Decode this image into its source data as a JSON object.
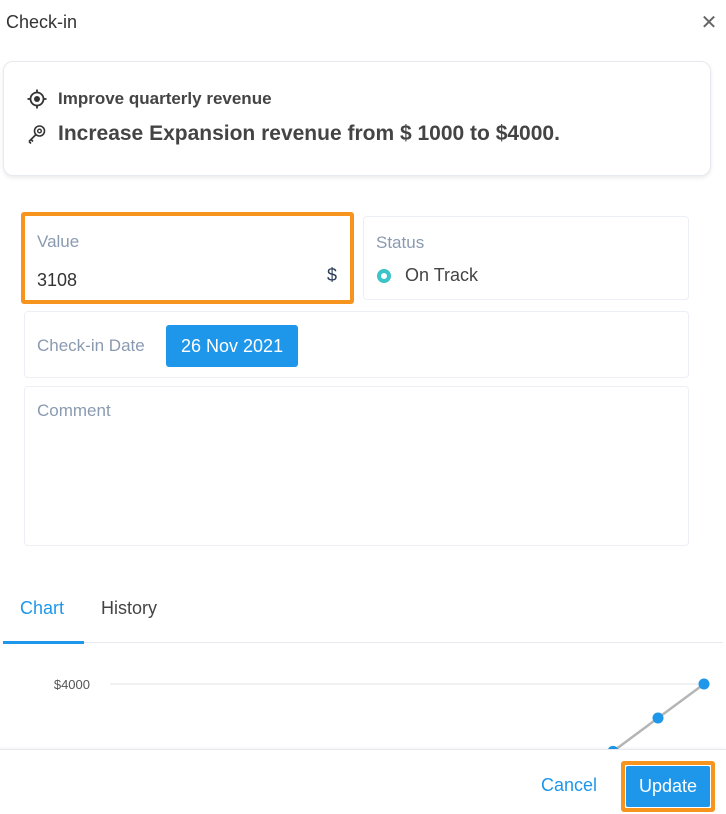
{
  "header": {
    "title": "Check-in",
    "close_icon": "close-icon"
  },
  "objective": {
    "title": "Improve quarterly revenue",
    "title_icon": "target-icon",
    "key_result": "Increase Expansion revenue from $ 1000 to $4000.",
    "key_result_icon": "key-icon"
  },
  "value_field": {
    "label": "Value",
    "value": "3108",
    "currency": "$"
  },
  "status_field": {
    "label": "Status",
    "value": "On Track",
    "color": "#3bc4c9"
  },
  "date_field": {
    "label": "Check-in Date",
    "value": "26 Nov 2021"
  },
  "comment_field": {
    "label": "Comment",
    "value": ""
  },
  "tabs": [
    {
      "label": "Chart",
      "active": true
    },
    {
      "label": "History",
      "active": false
    }
  ],
  "chart_data": {
    "type": "line",
    "y_tick_labels": [
      "$4000"
    ],
    "grid": true,
    "series": [
      {
        "values": [
          3108,
          3550,
          4000
        ]
      }
    ],
    "point_color": "#1e97ea",
    "line_color": "#b5b5b5"
  },
  "footer": {
    "cancel_label": "Cancel",
    "update_label": "Update"
  },
  "colors": {
    "accent": "#1e97ea",
    "highlight": "#f7941d",
    "on_track": "#3bc4c9"
  }
}
